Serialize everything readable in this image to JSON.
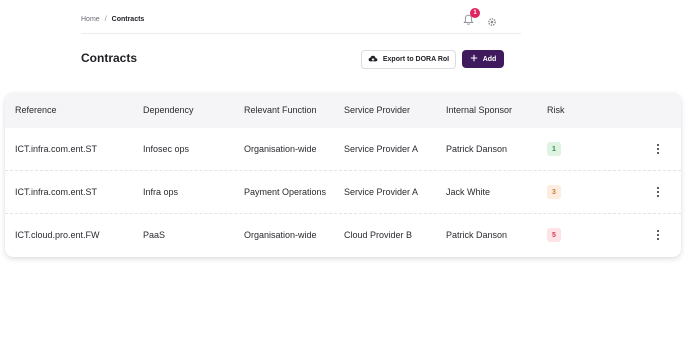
{
  "breadcrumb": {
    "home": "Home",
    "separator": "/",
    "current": "Contracts"
  },
  "notifications": {
    "count": "1",
    "badge_color": "#e0245e"
  },
  "page": {
    "title": "Contracts"
  },
  "actions": {
    "export_label": "Export to DORA RoI",
    "add_label": "Add",
    "add_color": "#3f1a5c"
  },
  "table": {
    "headers": {
      "reference": "Reference",
      "dependency": "Dependency",
      "function": "Relevant Function",
      "provider": "Service Provider",
      "sponsor": "Internal Sponsor",
      "risk": "Risk"
    },
    "rows": [
      {
        "reference": "ICT.infra.com.ent.ST",
        "dependency": "Infosec ops",
        "function": "Organisation-wide",
        "provider": "Service Provider A",
        "sponsor": "Patrick Danson",
        "risk": "1"
      },
      {
        "reference": "ICT.infra.com.ent.ST",
        "dependency": "Infra ops",
        "function": "Payment Operations",
        "provider": "Service Provider A",
        "sponsor": "Jack White",
        "risk": "3"
      },
      {
        "reference": "ICT.cloud.pro.ent.FW",
        "dependency": "PaaS",
        "function": "Organisation-wide",
        "provider": "Cloud Provider B",
        "sponsor": "Patrick Danson",
        "risk": "5"
      }
    ]
  },
  "icons": {
    "notifications": "bell-icon",
    "settings": "gear-icon",
    "export": "cloud-upload-icon",
    "add": "plus-icon",
    "row_menu": "more-vertical-icon"
  }
}
